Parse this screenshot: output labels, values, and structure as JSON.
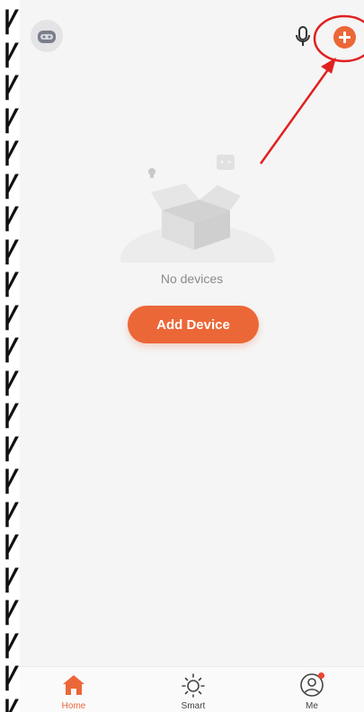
{
  "edge_strip": {
    "glyph": "Ꝩ",
    "count": 22
  },
  "header": {
    "avatar_icon": "robot-avatar-icon",
    "mic_icon": "microphone-icon",
    "add_icon": "plus-circle-icon"
  },
  "empty_state": {
    "illustration_icon": "empty-box-illustration",
    "message": "No devices",
    "add_button_label": "Add Device"
  },
  "tabbar": {
    "tabs": [
      {
        "label": "Home",
        "icon": "home-icon",
        "active": true
      },
      {
        "label": "Smart",
        "icon": "sun-icon",
        "active": false
      },
      {
        "label": "Me",
        "icon": "person-icon",
        "active": false,
        "badge": true
      }
    ]
  },
  "colors": {
    "accent": "#ec6737",
    "background": "#f5f5f5",
    "annotation": "#e02020",
    "badge": "#e9452f"
  }
}
